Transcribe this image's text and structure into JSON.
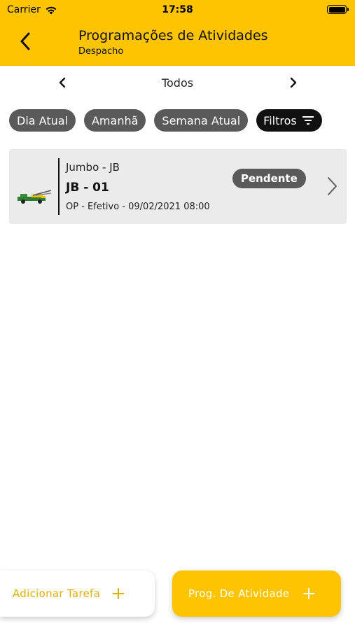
{
  "status_bar": {
    "carrier": "Carrier",
    "time": "17:58"
  },
  "header": {
    "title": "Programações de Atividades",
    "subtitle": "Despacho"
  },
  "period": {
    "label": "Todos"
  },
  "chips": [
    {
      "label": "Dia Atual"
    },
    {
      "label": "Amanhã"
    },
    {
      "label": "Semana Atual"
    },
    {
      "label": "Filtros",
      "icon": "filter-icon"
    }
  ],
  "items": [
    {
      "type": "Jumbo - JB",
      "code": "JB - 01",
      "meta": "OP - Efetivo - 09/02/2021 08:00",
      "status": "Pendente"
    }
  ],
  "buttons": {
    "add_task": "Adicionar Tarefa",
    "prog_activity": "Prog. De Atividade"
  },
  "colors": {
    "accent": "#FFC400",
    "chip": "#5a5a5a",
    "chip_dark": "#111111",
    "card": "#ebebeb"
  }
}
